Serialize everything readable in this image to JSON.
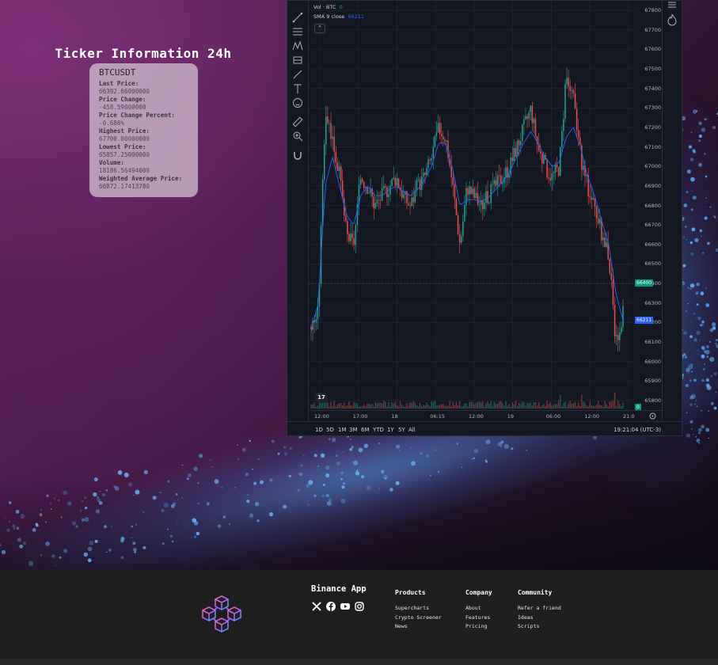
{
  "ticker": {
    "title": "Ticker Information 24h",
    "symbol": "BTCUSDT",
    "fields": [
      {
        "label": "Last Price:",
        "value": "66392.66000000"
      },
      {
        "label": "Price Change:",
        "value": "-458.59000000"
      },
      {
        "label": "Price Change Percent:",
        "value": "-0.686%"
      },
      {
        "label": "Highest Price:",
        "value": "67700.00000000"
      },
      {
        "label": "Lowest Price:",
        "value": "65857.25000000"
      },
      {
        "label": "Volume:",
        "value": "18186.56494000"
      },
      {
        "label": "Weighted Average Price:",
        "value": "66872.17413780"
      }
    ]
  },
  "chart_widget": {
    "legend": {
      "vol_label": "Vol · BTC",
      "vol_value": "0",
      "sma_label": "SMA 9 close",
      "sma_value": "66211"
    },
    "collapse_glyph": "⌃",
    "tv_logo": "17",
    "price_ticks": [
      "67800",
      "67700",
      "67600",
      "67500",
      "67400",
      "67300",
      "67200",
      "67100",
      "67000",
      "66900",
      "66800",
      "66700",
      "66600",
      "66500",
      "66400",
      "66300",
      "66200",
      "66100",
      "66000",
      "65900",
      "65800"
    ],
    "price_tag_last": "66400",
    "price_tag_sma": "66211",
    "volume_tag": "0",
    "time_labels": [
      "12:00",
      "17:00",
      "18",
      "06:15",
      "12:00",
      "19",
      "06:00",
      "12:00",
      "21:0"
    ],
    "ranges": [
      "1D",
      "5D",
      "1M",
      "3M",
      "6M",
      "YTD",
      "1Y",
      "5Y",
      "All"
    ],
    "clock": "19:21:04 (UTC-3)",
    "colors": {
      "up": "#26a69a",
      "down": "#ef5350",
      "sma": "#2962ff",
      "bg": "#131722"
    }
  },
  "chart_data": {
    "type": "candlestick",
    "symbol": "BTCUSDT",
    "ylim": [
      65800,
      67800
    ],
    "x": [
      "12:00",
      "17:00",
      "18",
      "06:15",
      "12:00",
      "19",
      "06:00",
      "12:00",
      "21:0"
    ],
    "series": [
      {
        "name": "price",
        "values": [
          66180,
          66250,
          67300,
          67150,
          66950,
          66650,
          66600,
          66950,
          66900,
          66800,
          66850,
          66900,
          66950,
          66850,
          66800,
          66900,
          66950,
          67050,
          67200,
          67150,
          66900,
          66600,
          66900,
          66850,
          66800,
          66850,
          66900,
          66950,
          67000,
          67100,
          67200,
          67300,
          67100,
          67000,
          66950,
          67000,
          67450,
          67350,
          67050,
          66900,
          66800,
          66650,
          66550,
          66100,
          66250
        ]
      },
      {
        "name": "SMA 9 close",
        "values": [
          66150,
          66300,
          66900,
          67050,
          66900,
          66750,
          66700,
          66850,
          66900,
          66850,
          66850,
          66880,
          66900,
          66870,
          66850,
          66880,
          66930,
          67000,
          67120,
          67120,
          66980,
          66800,
          66830,
          66830,
          66820,
          66840,
          66880,
          66920,
          66970,
          67050,
          67120,
          67180,
          67120,
          67050,
          67000,
          67020,
          67150,
          67200,
          67100,
          66950,
          66850,
          66720,
          66600,
          66350,
          66211
        ]
      }
    ]
  },
  "footer": {
    "app_title": "Binance App",
    "socials": [
      "x-icon",
      "facebook-icon",
      "youtube-icon",
      "instagram-icon"
    ],
    "columns": [
      {
        "heading": "Products",
        "links": [
          "Supercharts",
          "Crypto Screener",
          "News"
        ]
      },
      {
        "heading": "Company",
        "links": [
          "About",
          "Features",
          "Pricing"
        ]
      },
      {
        "heading": "Community",
        "links": [
          "Refer a friend",
          "Ideas",
          "Scripts"
        ]
      }
    ]
  }
}
